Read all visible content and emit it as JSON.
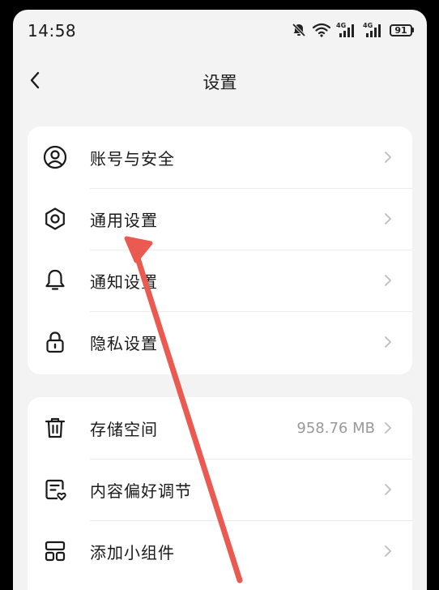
{
  "status_bar": {
    "time": "14:58",
    "battery_level": "91",
    "signal_1_label": "4G",
    "signal_2_label": "4G"
  },
  "header": {
    "title": "设置",
    "back_icon": "chevron-left-icon"
  },
  "groups": [
    {
      "items": [
        {
          "label": "账号与安全",
          "icon": "account-icon"
        },
        {
          "label": "通用设置",
          "icon": "gear-icon"
        },
        {
          "label": "通知设置",
          "icon": "bell-icon"
        },
        {
          "label": "隐私设置",
          "icon": "lock-icon"
        }
      ]
    },
    {
      "items": [
        {
          "label": "存储空间",
          "icon": "trash-icon",
          "value": "958.76 MB"
        },
        {
          "label": "内容偏好调节",
          "icon": "content-preference-icon"
        },
        {
          "label": "添加小组件",
          "icon": "widget-icon"
        }
      ]
    }
  ],
  "colors": {
    "background": "#f3f3f3",
    "card": "#ffffff",
    "text_primary": "#1a1a1a",
    "text_secondary": "#999999",
    "annotation_arrow": "#ea5a50"
  }
}
